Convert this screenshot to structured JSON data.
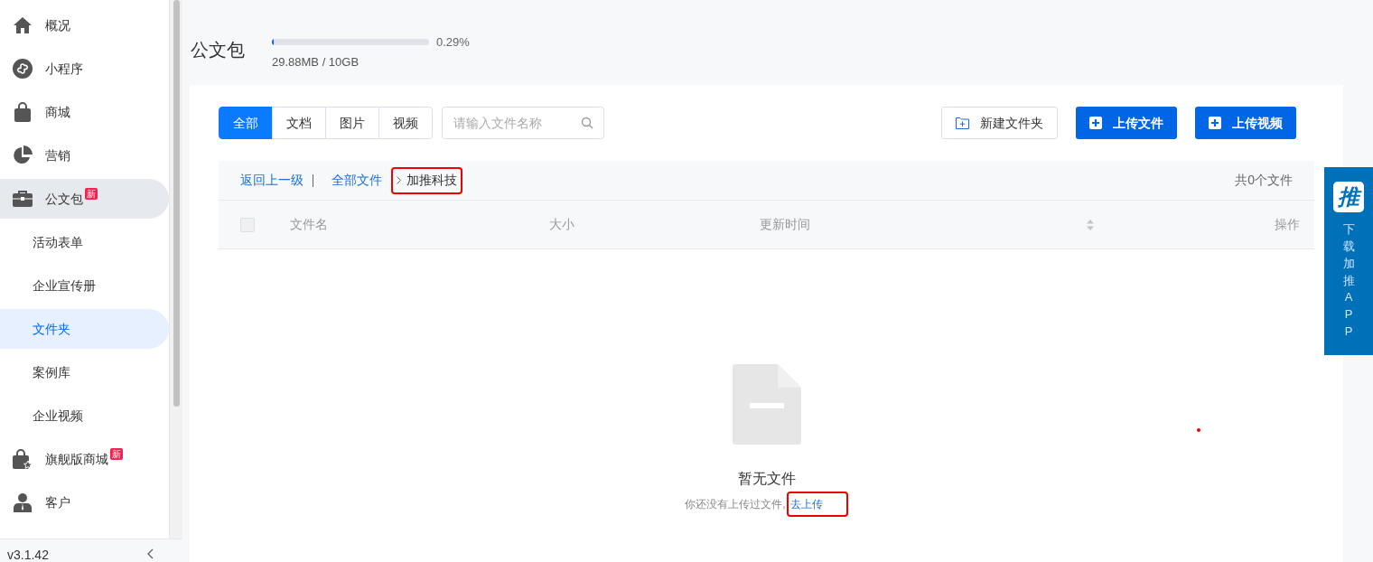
{
  "sidebar": {
    "items": [
      {
        "label": "概况",
        "selected": false
      },
      {
        "label": "小程序",
        "selected": false
      },
      {
        "label": "商城",
        "selected": false
      },
      {
        "label": "营销",
        "selected": false
      },
      {
        "label": "公文包",
        "badge": "新",
        "selected": false,
        "expanded": true,
        "children": [
          {
            "label": "活动表单",
            "selected": false
          },
          {
            "label": "企业宣传册",
            "selected": false
          },
          {
            "label": "文件夹",
            "selected": true
          },
          {
            "label": "案例库",
            "selected": false
          },
          {
            "label": "企业视频",
            "selected": false
          }
        ]
      },
      {
        "label": "旗舰版商城",
        "badge": "新",
        "selected": false
      },
      {
        "label": "客户",
        "selected": false
      }
    ],
    "version": "v3.1.42"
  },
  "page": {
    "title": "公文包",
    "storage": {
      "level": 0.0029,
      "percent": "0.29%",
      "usage": "29.88MB / 10GB"
    }
  },
  "filter_tabs": [
    {
      "label": "全部",
      "selected": true
    },
    {
      "label": "文档",
      "selected": false
    },
    {
      "label": "图片",
      "selected": false
    },
    {
      "label": "视频",
      "selected": false
    }
  ],
  "search": {
    "placeholder": "请输入文件名称"
  },
  "buttons": [
    {
      "label": "新建文件夹",
      "kind": "outline"
    },
    {
      "label": "上传文件",
      "kind": "primary"
    },
    {
      "label": "上传视频",
      "kind": "primary"
    }
  ],
  "breadcrumb": {
    "back": "返回上一级",
    "items": [
      {
        "label": "全部文件",
        "highlighted": false
      },
      {
        "label": "加推科技",
        "highlighted": true
      }
    ],
    "count": "共0个文件"
  },
  "table": {
    "select_all": {
      "checked": false
    },
    "columns": [
      "文件名",
      "大小",
      "更新时间",
      "操作"
    ]
  },
  "empty": {
    "title": "暂无文件",
    "message": "你还没有上传过文件,",
    "link": {
      "label": "去上传",
      "highlighted": true
    }
  },
  "app_panel": {
    "logo": "推",
    "text": "下载加推APP"
  }
}
